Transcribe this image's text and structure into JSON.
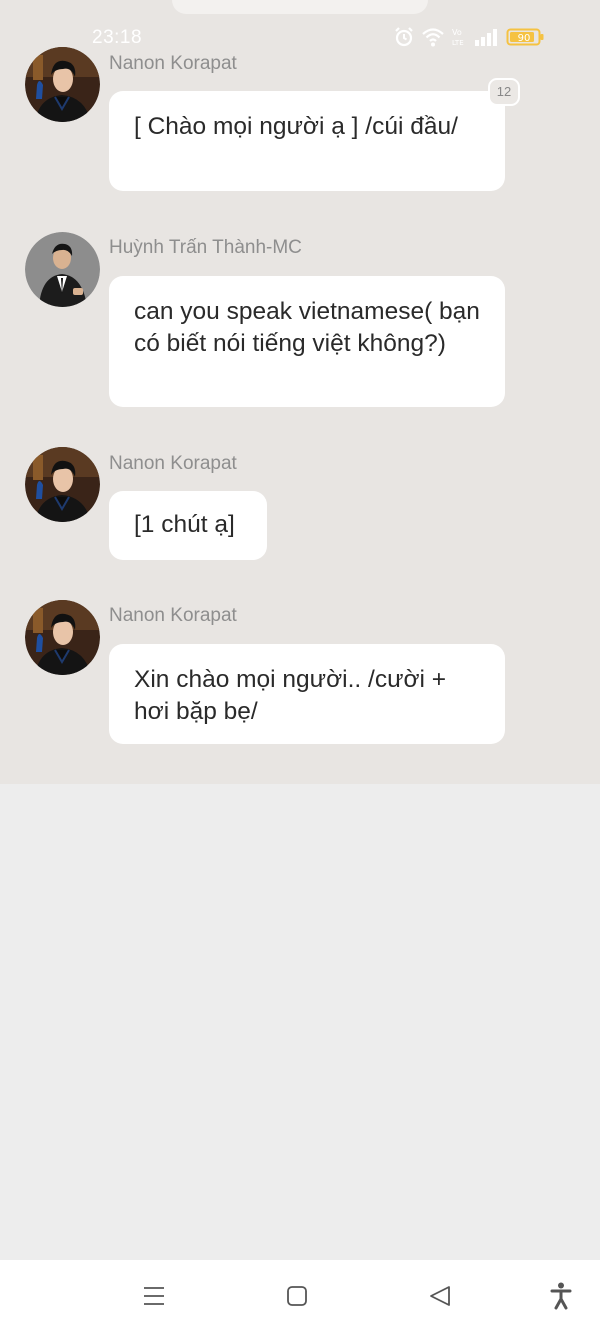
{
  "status_bar": {
    "time": "23:18",
    "battery_level": "90",
    "network_label_top": "Vo",
    "network_label_bottom": "LTE",
    "icons": [
      "alarm-icon",
      "wifi-icon",
      "volte-icon",
      "signal-icon",
      "battery-icon"
    ]
  },
  "messages": [
    {
      "sender": "Nanon Korapat",
      "text": "[ Chào mọi người ạ ] /cúi đầu/",
      "badge": "12",
      "avatar": "nanon-avatar"
    },
    {
      "sender": "Huỳnh Trấn Thành-MC",
      "text": "can you speak vietnamese( bạn có biết nói tiếng việt không?)",
      "avatar": "tranthanh-avatar"
    },
    {
      "sender": "Nanon Korapat",
      "text": "[1 chút ạ]",
      "avatar": "nanon-avatar"
    },
    {
      "sender": "Nanon Korapat",
      "text": "Xin chào mọi người.. /cười + hơi bặp bẹ/",
      "avatar": "nanon-avatar"
    }
  ],
  "nav_bar": {
    "buttons": [
      "menu-icon",
      "home-icon",
      "back-icon",
      "accessibility-icon"
    ]
  },
  "colors": {
    "chat_background": "#e8e5e2",
    "page_background": "#ededed",
    "bubble": "#ffffff",
    "sender_name": "#8e8e8e",
    "battery": "#f5c242"
  }
}
